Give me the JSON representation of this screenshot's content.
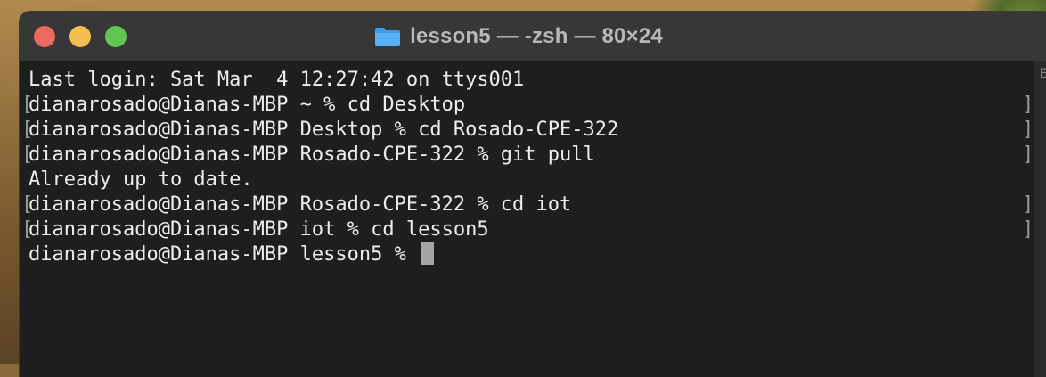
{
  "window": {
    "title": "lesson5 — -zsh — 80×24",
    "folder_icon": "folder-icon",
    "buttons": {
      "close": "close-button",
      "minimize": "minimize-button",
      "zoom": "zoom-button"
    },
    "colors": {
      "close": "#ed6a5e",
      "minimize": "#f5bf4f",
      "zoom": "#61c554",
      "folder": "#3d9be9"
    }
  },
  "terminal": {
    "lines": [
      "Last login: Sat Mar  4 12:27:42 on ttys001",
      "dianarosado@Dianas-MBP ~ % cd Desktop",
      "dianarosado@Dianas-MBP Desktop % cd Rosado-CPE-322",
      "dianarosado@Dianas-MBP Rosado-CPE-322 % git pull",
      "Already up to date.",
      "dianarosado@Dianas-MBP Rosado-CPE-322 % cd iot",
      "dianarosado@Dianas-MBP iot % cd lesson5",
      "dianarosado@Dianas-MBP lesson5 % "
    ],
    "bracket_left": "[",
    "bracket_right": "]",
    "scroll_marker": "E"
  }
}
